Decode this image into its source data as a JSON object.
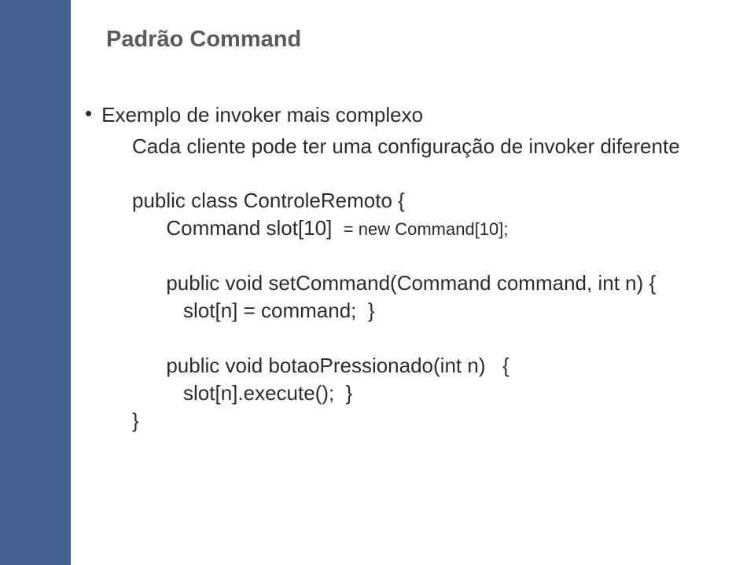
{
  "slide": {
    "title": "Padrão Command",
    "bullet": "Exemplo de invoker mais complexo",
    "subline": "Cada cliente pode ter uma configuração de invoker diferente",
    "code": {
      "l1": "public class ControleRemoto {",
      "l2_a": "      Command slot[10]  ",
      "l2_b": "= new Command[10];",
      "l3": "      public void setCommand(Command command, int n) {",
      "l4": "         slot[n] = command;  }",
      "l5": "      public void botaoPressionado(int n)   {",
      "l6": "         slot[n].execute();  }",
      "l7": "}"
    }
  }
}
